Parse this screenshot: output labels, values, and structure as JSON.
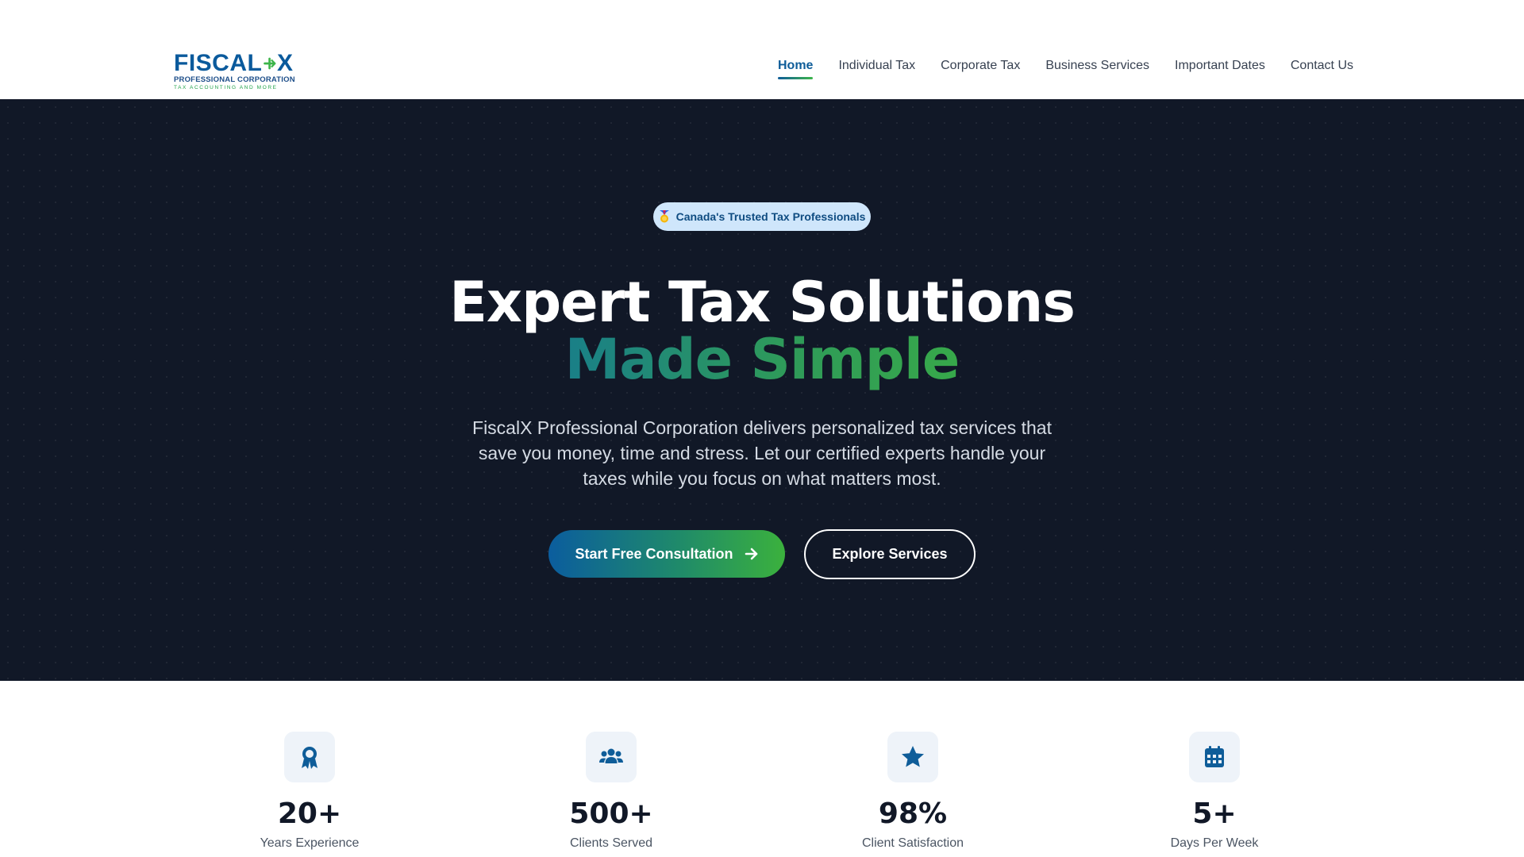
{
  "brand": {
    "name": "FISCAL",
    "name_end": "X",
    "subtitle": "PROFESSIONAL CORPORATION",
    "tagline": "TAX ACCOUNTING AND MORE"
  },
  "nav": {
    "items": [
      {
        "label": "Home",
        "active": true
      },
      {
        "label": "Individual Tax",
        "active": false
      },
      {
        "label": "Corporate Tax",
        "active": false
      },
      {
        "label": "Business Services",
        "active": false
      },
      {
        "label": "Important Dates",
        "active": false
      },
      {
        "label": "Contact Us",
        "active": false
      }
    ]
  },
  "hero": {
    "badge": {
      "icon": "medal-icon",
      "text": "Canada's Trusted Tax Professionals"
    },
    "title_line1": "Expert Tax Solutions",
    "title_line2": "Made Simple",
    "description": "FiscalX Professional Corporation delivers personalized tax services that save you money, time and stress. Let our certified experts handle your taxes while you focus on what matters most.",
    "primary_button": {
      "label": "Start Free Consultation",
      "icon": "arrow-right-icon"
    },
    "secondary_button": {
      "label": "Explore Services"
    }
  },
  "stats": [
    {
      "icon": "award-icon",
      "value": "20+",
      "label": "Years Experience"
    },
    {
      "icon": "users-icon",
      "value": "500+",
      "label": "Clients Served"
    },
    {
      "icon": "star-icon",
      "value": "98%",
      "label": "Client Satisfaction"
    },
    {
      "icon": "calendar-icon",
      "value": "5+",
      "label": "Days Per Week"
    }
  ],
  "colors": {
    "hero_background": "#111827",
    "primary_blue": "#0f5d99",
    "primary_green": "#3bb13d",
    "badge_background": "#cfe6fb"
  }
}
